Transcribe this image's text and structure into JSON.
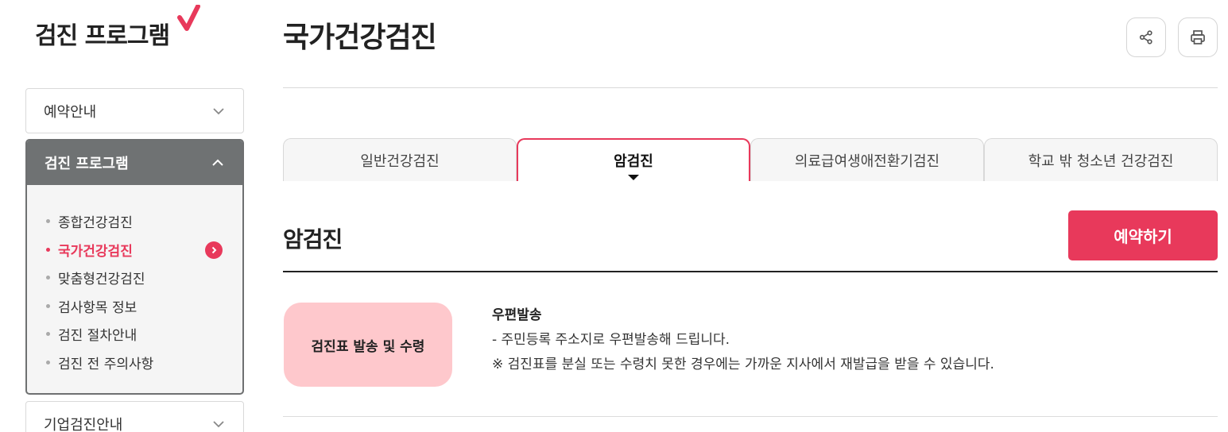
{
  "brand": {
    "text": "검진 프로그램",
    "accent_color": "#e8395b"
  },
  "sidebar": {
    "reserve_label": "예약안내",
    "program_label": "검진 프로그램",
    "items": [
      {
        "label": "종합건강검진"
      },
      {
        "label": "국가건강검진"
      },
      {
        "label": "맞춤형건강검진"
      },
      {
        "label": "검사항목 정보"
      },
      {
        "label": "검진 절차안내"
      },
      {
        "label": "검진 전 주의사항"
      }
    ],
    "active_item": "국가건강검진",
    "corp_label": "기업검진안내"
  },
  "main": {
    "title": "국가건강검진",
    "actions": {
      "share_icon": "share-icon",
      "print_icon": "print-icon"
    },
    "tabs": [
      {
        "label": "일반건강검진"
      },
      {
        "label": "암검진"
      },
      {
        "label": "의료급여생애전환기검진"
      },
      {
        "label": "학교 밖 청소년 건강검진"
      }
    ],
    "active_tab": "암검진",
    "section_title": "암검진",
    "reserve_button": "예약하기",
    "block": {
      "pill_label": "검진표 발송 및 수령",
      "heading": "우편발송",
      "line1": "- 주민등록 주소지로 우편발송해 드립니다.",
      "line2": "※ 검진표를 분실 또는 수령치 못한 경우에는 가까운 지사에서 재발급을 받을 수 있습니다."
    }
  },
  "colors": {
    "accent": "#e8395b",
    "pill_bg": "#fec8cc",
    "sidebar_head": "#6f7273"
  }
}
